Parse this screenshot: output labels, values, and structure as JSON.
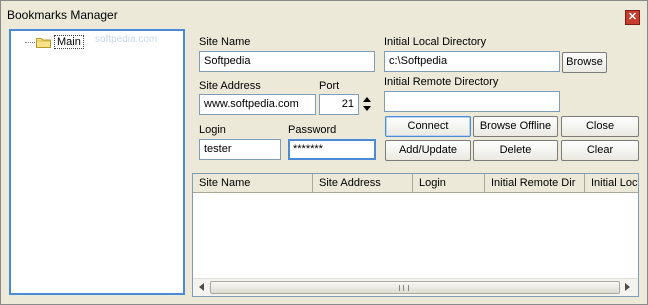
{
  "window": {
    "title": "Bookmarks Manager",
    "close_glyph": "✕"
  },
  "tree": {
    "root_label": "Main",
    "watermark": "softpedia.com",
    "folder_icon": "folder-icon"
  },
  "form": {
    "site_name_label": "Site Name",
    "site_name_value": "Softpedia",
    "site_address_label": "Site Address",
    "site_address_value": "www.softpedia.com",
    "port_label": "Port",
    "port_value": "21",
    "login_label": "Login",
    "login_value": "tester",
    "password_label": "Password",
    "password_value": "*******",
    "local_dir_label": "Initial Local Directory",
    "local_dir_value": "c:\\Softpedia",
    "remote_dir_label": "Initial Remote Directory",
    "remote_dir_value": ""
  },
  "buttons": {
    "browse": "Browse",
    "connect": "Connect",
    "browse_offline": "Browse Offline",
    "close": "Close",
    "add_update": "Add/Update",
    "delete": "Delete",
    "clear": "Clear"
  },
  "table": {
    "columns": [
      "Site Name",
      "Site Address",
      "Login",
      "Initial Remote Dir",
      "Initial Local Dir"
    ]
  },
  "colors": {
    "focus_border": "#4b8ad6",
    "window_bg": "#ece9d8"
  }
}
